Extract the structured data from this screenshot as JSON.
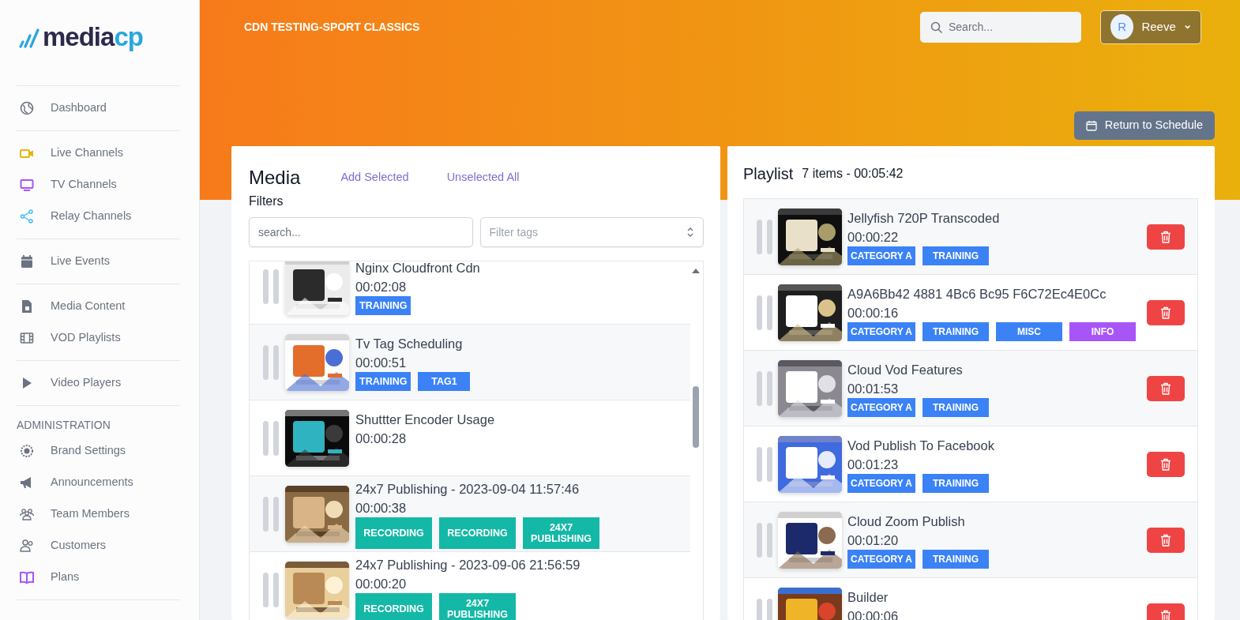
{
  "sidebar": {
    "logo": [
      "media",
      "cp"
    ],
    "sections": [
      {
        "items": [
          {
            "label": "Dashboard",
            "color": "#6b7280"
          }
        ]
      },
      {
        "items": [
          {
            "label": "Live Channels",
            "color": "#eab308"
          },
          {
            "label": "TV Channels",
            "color": "#a855f7"
          },
          {
            "label": "Relay Channels",
            "color": "#38bdf8"
          }
        ]
      },
      {
        "items": [
          {
            "label": "Live Events",
            "color": "#6b7280"
          }
        ]
      },
      {
        "items": [
          {
            "label": "Media Content",
            "color": "#6b7280"
          },
          {
            "label": "VOD Playlists",
            "color": "#6b7280"
          }
        ]
      },
      {
        "items": [
          {
            "label": "Video Players",
            "color": "#6b7280"
          }
        ]
      },
      {
        "heading": "ADMINISTRATION",
        "items": [
          {
            "label": "Brand Settings",
            "color": "#6b7280"
          },
          {
            "label": "Announcements",
            "color": "#6b7280"
          },
          {
            "label": "Team Members",
            "color": "#6b7280"
          },
          {
            "label": "Customers",
            "color": "#6b7280"
          },
          {
            "label": "Plans",
            "color": "#a855f7"
          }
        ]
      }
    ]
  },
  "header": {
    "title": "CDN TESTING-SPORT CLASSICS",
    "search": {
      "placeholder": "Search..."
    },
    "user": {
      "initial": "R",
      "name": "Reeve"
    },
    "return_button": "Return to Schedule"
  },
  "media": {
    "title": "Media",
    "actions": [
      "Add Selected",
      "Unselected All"
    ],
    "filters_label": "Filters",
    "search": {
      "placeholder": "search..."
    },
    "tag_filter": {
      "placeholder": "Filter tags"
    },
    "items": [
      {
        "title": "Nginx Cloudfront Cdn",
        "duration": "00:02:08",
        "tags": [
          {
            "label": "TRAINING",
            "color": "#3b82f6",
            "kind": "compact"
          }
        ]
      },
      {
        "title": "Tv Tag Scheduling",
        "duration": "00:00:51",
        "tags": [
          {
            "label": "TRAINING",
            "color": "#3b82f6",
            "kind": "compact"
          },
          {
            "label": "TAG1",
            "color": "#3b82f6",
            "kind": "compact"
          }
        ]
      },
      {
        "title": "Shuttter Encoder Usage",
        "duration": "00:00:28"
      },
      {
        "title": "24x7 Publishing - 2023-09-04 11:57:46",
        "duration": "00:00:38",
        "tags": [
          {
            "label": "RECORDING",
            "color": "#14b8a6",
            "kind": "wide"
          },
          {
            "label": "RECORDING",
            "color": "#14b8a6",
            "kind": "wide"
          },
          {
            "label": "24X7 PUBLISHING",
            "color": "#14b8a6",
            "kind": "wide"
          }
        ]
      },
      {
        "title": "24x7 Publishing - 2023-09-06 21:56:59",
        "duration": "00:00:20",
        "tags": [
          {
            "label": "RECORDING",
            "color": "#14b8a6",
            "kind": "wide"
          },
          {
            "label": "24X7 PUBLISHING",
            "color": "#14b8a6",
            "kind": "wide"
          }
        ]
      }
    ]
  },
  "playlist": {
    "title": "Playlist",
    "summary": "7 items - 00:05:42",
    "items": [
      {
        "title": "Jellyfish 720P Transcoded",
        "duration": "00:00:22",
        "tags": [
          {
            "label": "CATEGORY A",
            "color": "#3b82f6"
          },
          {
            "label": "TRAINING",
            "color": "#3b82f6"
          }
        ]
      },
      {
        "title": "A9A6Bb42 4881 4Bc6 Bc95 F6C72Ec4E0Cc",
        "duration": "00:00:16",
        "tags": [
          {
            "label": "CATEGORY A",
            "color": "#3b82f6"
          },
          {
            "label": "TRAINING",
            "color": "#3b82f6"
          },
          {
            "label": "MISC",
            "color": "#3b82f6"
          },
          {
            "label": "INFO",
            "color": "#a855f7"
          }
        ]
      },
      {
        "title": "Cloud Vod Features",
        "duration": "00:01:53",
        "tags": [
          {
            "label": "CATEGORY A",
            "color": "#3b82f6"
          },
          {
            "label": "TRAINING",
            "color": "#3b82f6"
          }
        ]
      },
      {
        "title": "Vod Publish To Facebook",
        "duration": "00:01:23",
        "tags": [
          {
            "label": "CATEGORY A",
            "color": "#3b82f6"
          },
          {
            "label": "TRAINING",
            "color": "#3b82f6"
          }
        ]
      },
      {
        "title": "Cloud Zoom Publish",
        "duration": "00:01:20",
        "tags": [
          {
            "label": "CATEGORY A",
            "color": "#3b82f6"
          },
          {
            "label": "TRAINING",
            "color": "#3b82f6"
          }
        ]
      },
      {
        "title": "Builder",
        "duration": "00:00:06"
      }
    ]
  }
}
